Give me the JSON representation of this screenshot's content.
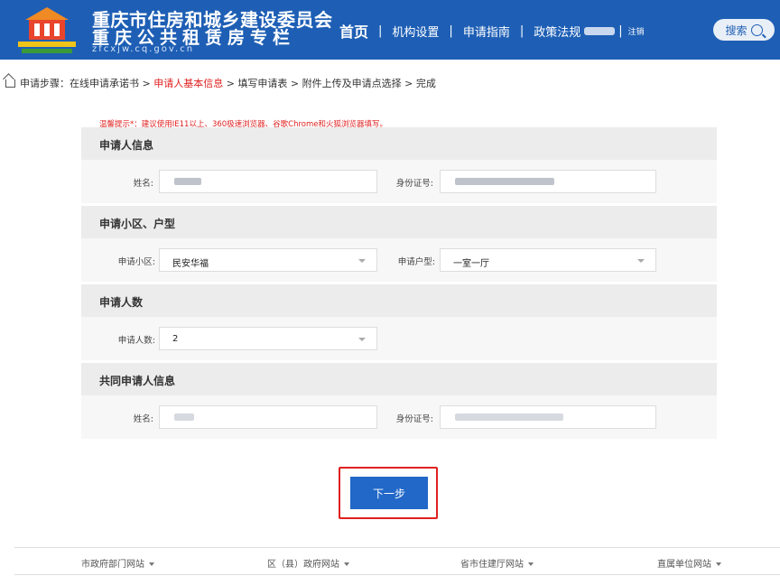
{
  "header": {
    "title_line1": "重庆市住房和城乡建设委员会",
    "title_line2": "重庆公共租赁房专栏",
    "domain": "zfcxjw.cq.gov.cn",
    "nav": {
      "home": "首页",
      "sep": "|",
      "org": "机构设置",
      "guide": "申请指南",
      "policy": "政策法规",
      "logout": "注销"
    },
    "search_label": "搜索"
  },
  "breadcrumb": {
    "prefix": "申请步骤：",
    "step1": "在线申请承诺书",
    "arrow": " > ",
    "step2": "申请人基本信息",
    "step3": "填写申请表",
    "step4": "附件上传及申请点选择",
    "step5": "完成"
  },
  "tip": "温馨提示*：建议使用IE11以上、360极速浏览器、谷歌Chrome和火狐浏览器填写。",
  "sections": {
    "applicant": {
      "heading": "申请人信息",
      "name_label": "姓名:",
      "id_label": "身份证号:"
    },
    "community": {
      "heading": "申请小区、户型",
      "community_label": "申请小区:",
      "community_value": "民安华福",
      "type_label": "申请户型:",
      "type_value": "一室一厅"
    },
    "count": {
      "heading": "申请人数",
      "count_label": "申请人数:",
      "count_value": "2"
    },
    "co_applicant": {
      "heading": "共同申请人信息",
      "name_label": "姓名:",
      "id_label": "身份证号:"
    }
  },
  "next_button": "下一步",
  "footer": {
    "link1": "市政府部门网站",
    "link2": "区（县）政府网站",
    "link3": "省市住建厅网站",
    "link4": "直属单位网站"
  },
  "colors": {
    "header_bg": "#1e5fb5",
    "accent_red": "#e02020",
    "button_blue": "#2168c8"
  }
}
